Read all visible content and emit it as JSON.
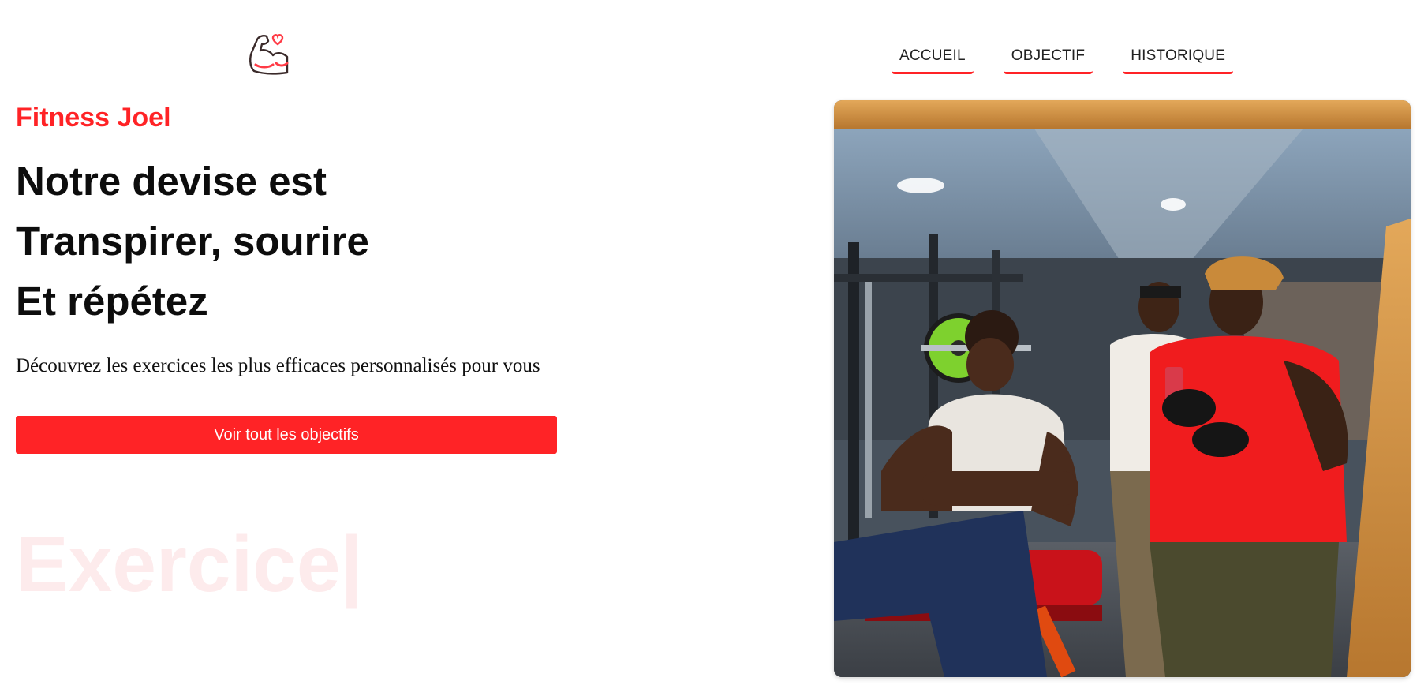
{
  "header": {
    "logo_icon": "flexed-arm-heart-icon",
    "nav": [
      {
        "label": "ACCUEIL"
      },
      {
        "label": "OBJECTIF"
      },
      {
        "label": "HISTORIQUE"
      }
    ]
  },
  "hero": {
    "brand": "Fitness Joel",
    "headline": [
      "Notre devise est",
      "Transpirer, sourire",
      "Et répétez"
    ],
    "subtitle": "Découvrez les exercices les plus efficaces personnalisés pour vous",
    "cta_label": "Voir tout les objectifs",
    "ghost_text": "Exercice|"
  },
  "colors": {
    "accent": "#ff2326",
    "ghost": "#fdebec",
    "text": "#111111"
  }
}
